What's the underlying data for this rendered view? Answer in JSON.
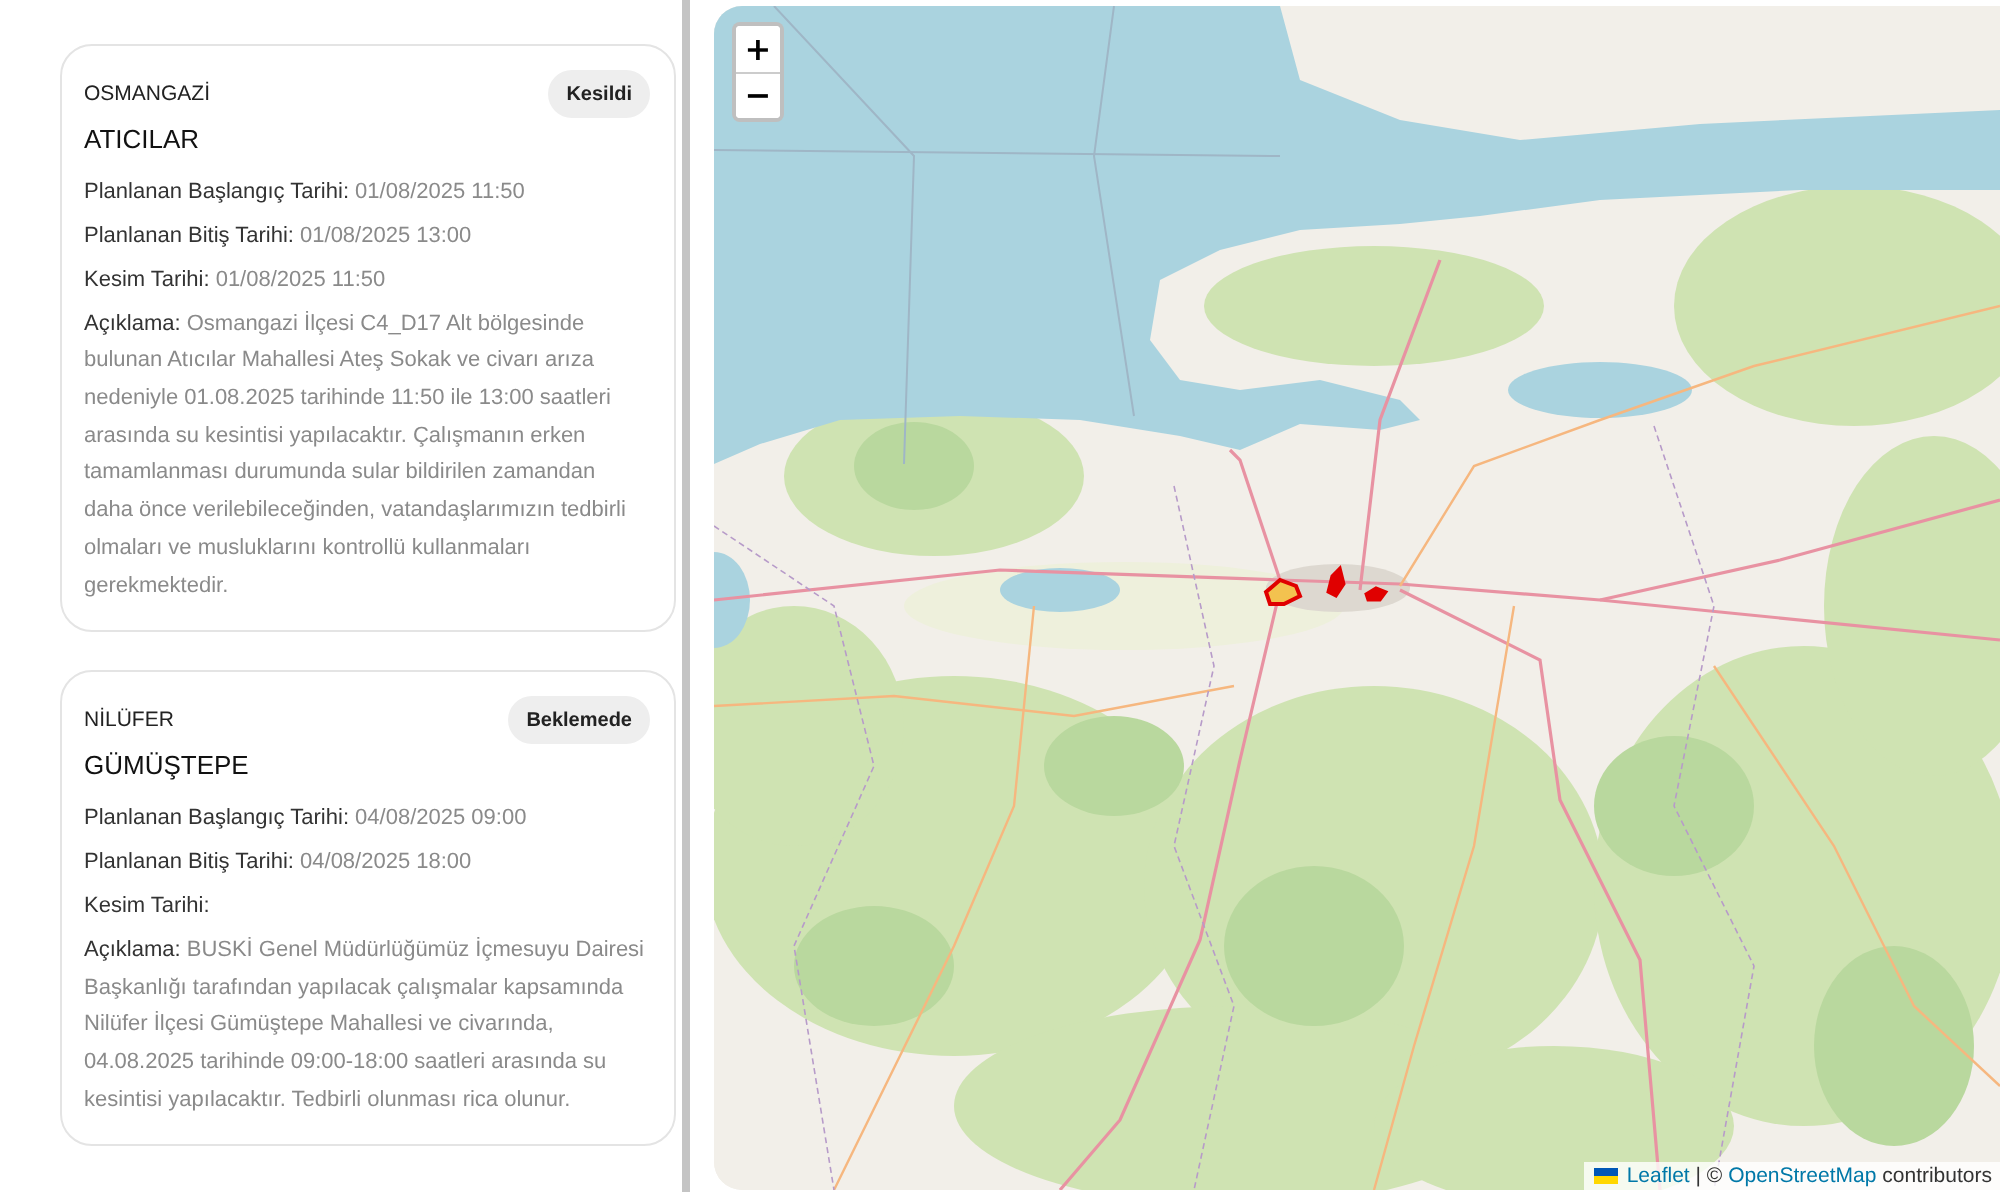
{
  "outages": [
    {
      "district": "OSMANGAZİ",
      "status": "Kesildi",
      "neighborhood": "ATICILAR",
      "fields": [
        {
          "label": "Planlanan Başlangıç Tarihi:",
          "value": "01/08/2025 11:50"
        },
        {
          "label": "Planlanan Bitiş Tarihi:",
          "value": "01/08/2025 13:00"
        },
        {
          "label": "Kesim Tarihi:",
          "value": "01/08/2025 11:50"
        },
        {
          "label": "Açıklama:",
          "value": "Osmangazi İlçesi C4_D17 Alt bölgesinde bulunan Atıcılar Mahallesi Ateş Sokak ve civarı arıza nedeniyle 01.08.2025 tarihinde 11:50 ile 13:00 saatleri arasında su kesintisi yapılacaktır. Çalışmanın erken tamamlanması durumunda sular bildirilen zamandan daha önce verilebileceğinden, vatandaşlarımızın tedbirli olmaları ve musluklarını kontrollü kullanmaları gerekmektedir."
        }
      ]
    },
    {
      "district": "NİLÜFER",
      "status": "Beklemede",
      "neighborhood": "GÜMÜŞTEPE",
      "fields": [
        {
          "label": "Planlanan Başlangıç Tarihi:",
          "value": "04/08/2025 09:00"
        },
        {
          "label": "Planlanan Bitiş Tarihi:",
          "value": "04/08/2025 18:00"
        },
        {
          "label": "Kesim Tarihi:"
        },
        {
          "label": "Açıklama:",
          "value": "BUSKİ Genel Müdürlüğümüz İçmesuyu Dairesi Başkanlığı tarafından yapılacak çalışmalar kapsamında Nilüfer İlçesi Gümüştepe Mahallesi ve civarında, 04.08.2025 tarihinde 09:00-18:00 saatleri arasında su kesintisi yapılacaktır. Tedbirli olunması rica olunur."
        }
      ]
    }
  ],
  "map": {
    "zoom_in": "+",
    "zoom_out": "−",
    "attribution": {
      "leaflet_link": "Leaflet",
      "separator": "|",
      "copyright": "©",
      "osm_link": "OpenStreetMap",
      "suffix": "contributors"
    }
  }
}
